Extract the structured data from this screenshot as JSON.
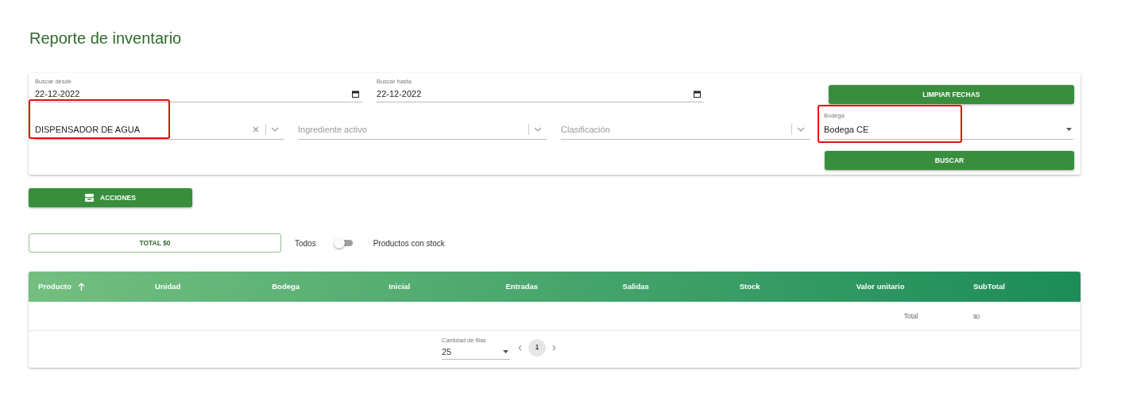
{
  "title": "Reporte de inventario",
  "date_fields": [
    {
      "label": "Buscar desde",
      "value": "22-12-2022"
    },
    {
      "label": "Buscar hasta",
      "value": "22-12-2022"
    }
  ],
  "clear_button": "LIMPIAR FECHAS",
  "filters": [
    {
      "kind": "combo",
      "value": "DISPENSADOR DE AGUA",
      "clearable": true,
      "highlighted": true
    },
    {
      "kind": "combo",
      "placeholder": "Ingrediente activo",
      "clearable": false,
      "highlighted": false
    },
    {
      "kind": "combo",
      "placeholder": "Clasificación",
      "clearable": false,
      "highlighted": false
    },
    {
      "kind": "select",
      "label": "Bodega",
      "value": "Bodega CE",
      "highlighted": true
    }
  ],
  "search_button": "BUSCAR",
  "actions_button": "ACCIONES",
  "total_button": "TOTAL $0",
  "stock_toggle": {
    "left_label": "Todos",
    "on": false,
    "right_label": "Productos con stock"
  },
  "table": {
    "columns": [
      {
        "label": "Producto",
        "sorted": true
      },
      {
        "label": "Unidad",
        "sorted": false
      },
      {
        "label": "Bodega",
        "sorted": false
      },
      {
        "label": "Inicial",
        "sorted": false
      },
      {
        "label": "Entradas",
        "sorted": false
      },
      {
        "label": "Salidas",
        "sorted": false
      },
      {
        "label": "Stock",
        "sorted": false
      },
      {
        "label": "Valor unitario",
        "sorted": false
      },
      {
        "label": "SubTotal",
        "sorted": false
      }
    ],
    "total_row": {
      "label": "Total",
      "value": "$0"
    }
  },
  "pagination": {
    "rows_label": "Cantidad de filas",
    "rows_value": "25",
    "pages": [
      {
        "label": "1",
        "selected": true
      }
    ]
  }
}
